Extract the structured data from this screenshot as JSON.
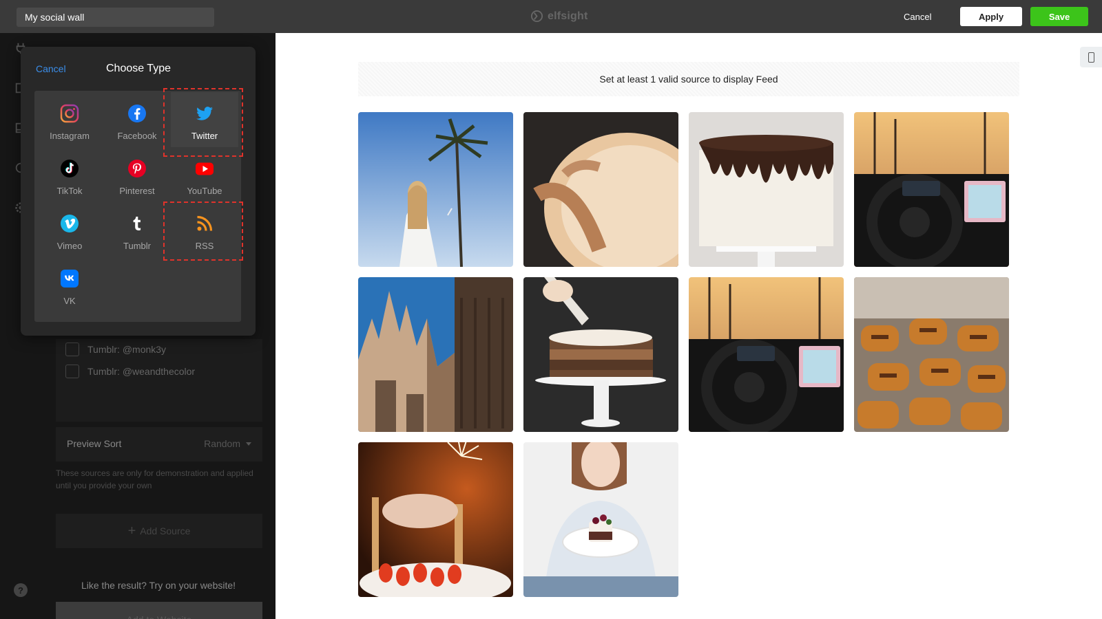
{
  "header": {
    "widget_name": "My social wall",
    "brand": "elfsight",
    "cancel_label": "Cancel",
    "apply_label": "Apply",
    "save_label": "Save"
  },
  "colors": {
    "topbar": "#3a3a3a",
    "save_green": "#3cc41a",
    "link_blue": "#3b8eea",
    "highlight_red": "#e0332b"
  },
  "popup": {
    "cancel_label": "Cancel",
    "title": "Choose Type",
    "types": [
      {
        "label": "Instagram",
        "icon": "instagram-icon"
      },
      {
        "label": "Facebook",
        "icon": "facebook-icon"
      },
      {
        "label": "Twitter",
        "icon": "twitter-icon"
      },
      {
        "label": "TikTok",
        "icon": "tiktok-icon"
      },
      {
        "label": "Pinterest",
        "icon": "pinterest-icon"
      },
      {
        "label": "YouTube",
        "icon": "youtube-icon"
      },
      {
        "label": "Vimeo",
        "icon": "vimeo-icon"
      },
      {
        "label": "Tumblr",
        "icon": "tumblr-icon"
      },
      {
        "label": "RSS",
        "icon": "rss-icon"
      },
      {
        "label": "VK",
        "icon": "vk-icon"
      }
    ]
  },
  "editor": {
    "sources": [
      {
        "label": "Tumblr: @monk3y"
      },
      {
        "label": "Tumblr: @weandthecolor"
      }
    ],
    "preview_sort": {
      "label": "Preview Sort",
      "value": "Random"
    },
    "hint": "These sources are only for demonstration and applied until you provide your own",
    "add_source_label": "Add Source",
    "cta_text": "Like the result? Try on your website!",
    "add_to_website_label": "Add to Website"
  },
  "preview": {
    "notice": "Set at least 1 valid source to display Feed",
    "tiles": [
      "woman-palm-tree-photo",
      "pie-crust-photo",
      "chocolate-drip-cake-photo",
      "car-dashboard-photo",
      "cathedral-photo",
      "piping-cake-photo",
      "car-dashboard-photo",
      "pastries-photo",
      "sparkler-cake-photo",
      "girl-holding-cake-photo"
    ]
  }
}
